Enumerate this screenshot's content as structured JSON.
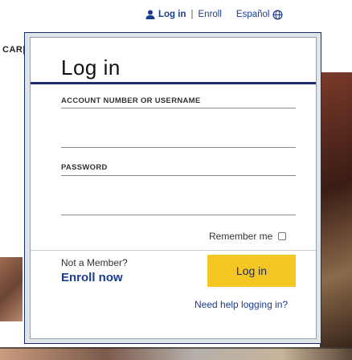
{
  "topbar": {
    "login_label": "Log in",
    "separator": "|",
    "enroll_label": "Enroll",
    "language_label": "Español"
  },
  "background": {
    "car_label": "CAR|"
  },
  "modal": {
    "title": "Log in",
    "account_label": "ACCOUNT NUMBER OR USERNAME",
    "account_value": "",
    "password_label": "PASSWORD",
    "password_value": "",
    "remember_label": "Remember me",
    "remember_checked": false,
    "not_member_label": "Not a Member?",
    "enroll_now_label": "Enroll now",
    "login_button_label": "Log in",
    "need_help_label": "Need help logging in?"
  },
  "colors": {
    "link_blue": "#1a3d8f",
    "accent_navy": "#1f2a6b",
    "button_yellow": "#f3c623"
  },
  "icons": [
    "user-icon",
    "globe-icon"
  ]
}
